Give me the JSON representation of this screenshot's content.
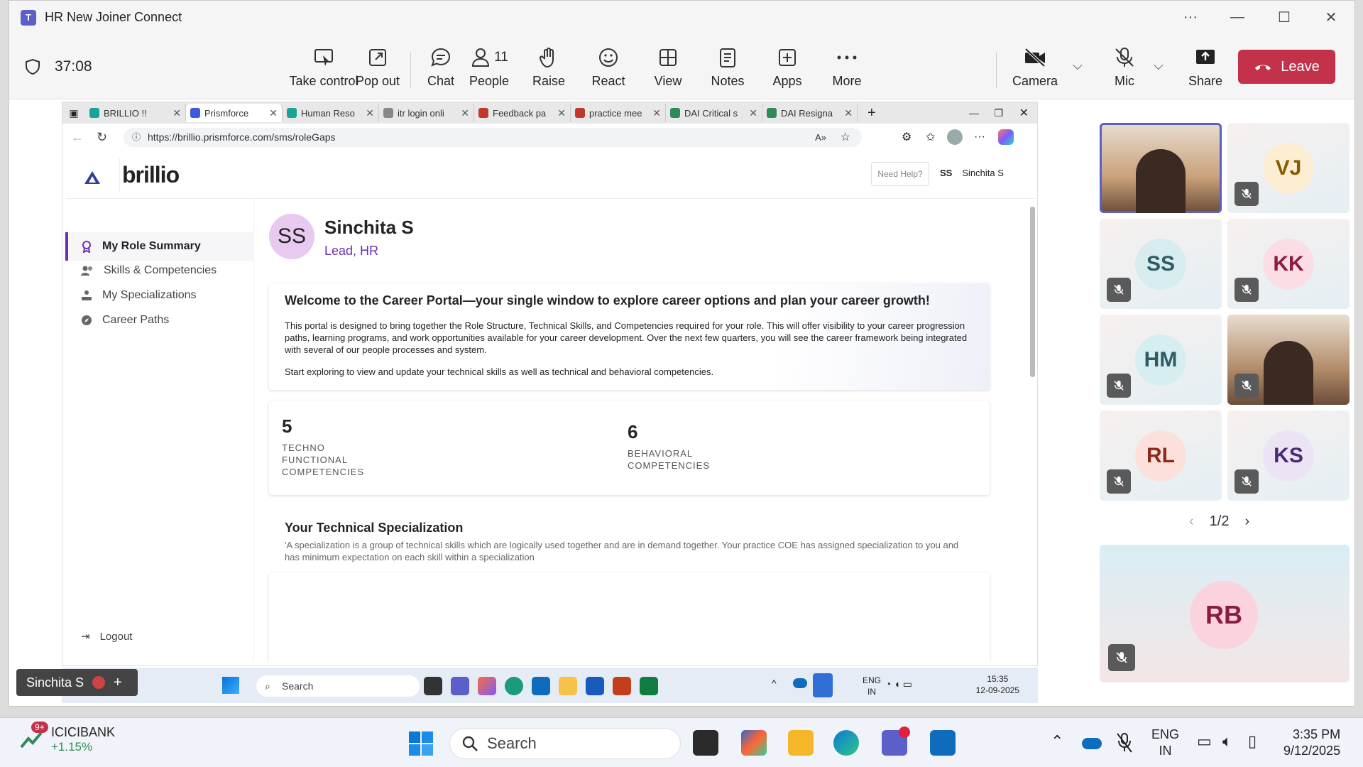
{
  "window": {
    "title": "HR New Joiner Connect"
  },
  "meeting": {
    "timer": "37:08",
    "buttons": [
      {
        "label": "Take control",
        "icon": "take-control-icon"
      },
      {
        "label": "Pop out",
        "icon": "pop-out-icon"
      },
      {
        "label": "Chat",
        "icon": "chat-icon"
      },
      {
        "label": "People",
        "icon": "people-icon",
        "count": "11"
      },
      {
        "label": "Raise",
        "icon": "raise-hand-icon"
      },
      {
        "label": "React",
        "icon": "react-icon"
      },
      {
        "label": "View",
        "icon": "view-icon"
      },
      {
        "label": "Notes",
        "icon": "notes-icon"
      },
      {
        "label": "Apps",
        "icon": "apps-icon"
      },
      {
        "label": "More",
        "icon": "more-icon"
      },
      {
        "label": "Camera",
        "icon": "camera-off-icon"
      },
      {
        "label": "Mic",
        "icon": "mic-off-icon"
      },
      {
        "label": "Share",
        "icon": "share-icon"
      }
    ],
    "leave_label": "Leave"
  },
  "browser": {
    "tabs": [
      {
        "label": "BRILLIO !!",
        "color": "#1aa39a"
      },
      {
        "label": "Prismforce",
        "color": "#3b5bdb",
        "active": true
      },
      {
        "label": "Human Reso",
        "color": "#1aa39a"
      },
      {
        "label": "itr login onli",
        "color": "#888888"
      },
      {
        "label": "Feedback pa",
        "color": "#c0392b"
      },
      {
        "label": "practice mee",
        "color": "#c0392b"
      },
      {
        "label": "DAI Critical s",
        "color": "#2e8b57"
      },
      {
        "label": "DAI Resigna",
        "color": "#2e8b57"
      }
    ],
    "url": "https://brillio.prismforce.com/sms/roleGaps"
  },
  "app": {
    "logo": "brillio",
    "need_help": "Need Help?",
    "user_initials": "SS",
    "user_name": "Sinchita S",
    "nav": [
      {
        "label": "My Role Summary",
        "icon": "ribbon-icon",
        "active": true
      },
      {
        "label": "Skills & Competencies",
        "icon": "people-icon"
      },
      {
        "label": "My Specializations",
        "icon": "hierarchy-icon"
      },
      {
        "label": "Career Paths",
        "icon": "compass-icon"
      }
    ],
    "logout": "Logout",
    "profile": {
      "initials": "SS",
      "name": "Sinchita S",
      "role": "Lead, HR"
    },
    "welcome": {
      "title": "Welcome to the Career Portal—your single window to explore career options and plan your career growth!",
      "body": "This portal is designed to bring together the Role Structure, Technical Skills, and Competencies required for your role. This will offer visibility to your career progression paths, learning programs, and work opportunities available for your career development. Over the next few quarters, you will see the career framework being integrated with several of our people processes and system.",
      "cta": "Start exploring to view and update your technical skills as well as technical and behavioral competencies."
    },
    "stats": [
      {
        "value": "5",
        "label_lines": [
          "TECHNO",
          "FUNCTIONAL",
          "COMPETENCIES"
        ]
      },
      {
        "value": "6",
        "label_lines": [
          "BEHAVIORAL",
          "COMPETENCIES"
        ]
      }
    ],
    "specialization": {
      "title": "Your Technical Specialization",
      "desc": "'A specialization is a group of technical skills which are logically used together and are in demand together. Your practice COE has assigned specialization to you and has minimum expectation on each skill within a specialization"
    }
  },
  "presenter_badge": "Sinchita S",
  "shared_taskbar": {
    "search": "Search",
    "lang": [
      "ENG",
      "IN"
    ],
    "time": "15:35",
    "date": "12-09-2025"
  },
  "participants": [
    {
      "initials": "",
      "video": true,
      "bg": "#c9a27a",
      "highlight": true
    },
    {
      "initials": "VJ",
      "bg": "#fbeed3",
      "fg": "#8a5a00",
      "muted": true
    },
    {
      "initials": "SS",
      "bg": "#d6ecef",
      "fg": "#2f5a66",
      "muted": true
    },
    {
      "initials": "KK",
      "bg": "#fbdde6",
      "fg": "#8b1c3c",
      "muted": true
    },
    {
      "initials": "HM",
      "bg": "#d6eef0",
      "fg": "#2f5a66",
      "muted": true
    },
    {
      "initials": "",
      "video": true,
      "bg": "#b38c6a",
      "muted": true
    },
    {
      "initials": "RL",
      "bg": "#fbe0dc",
      "fg": "#8b2a1c",
      "muted": true
    },
    {
      "initials": "KS",
      "bg": "#ece3f5",
      "fg": "#4a2a73",
      "muted": true
    }
  ],
  "pager": "1/2",
  "self_tile": {
    "initials": "RB",
    "fg": "#8b1c3c",
    "bg": "#fbd3df",
    "muted": true
  },
  "taskbar": {
    "stock_name": "ICICIBANK",
    "stock_change": "+1.15%",
    "badge": "9+",
    "search": "Search",
    "lang": [
      "ENG",
      "IN"
    ],
    "time": "3:35 PM",
    "date": "9/12/2025"
  }
}
